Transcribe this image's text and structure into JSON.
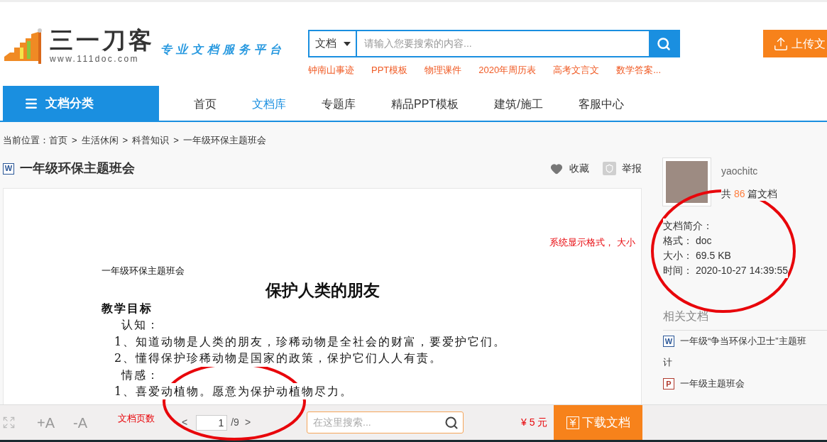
{
  "header": {
    "logo": {
      "name": "三一刀客",
      "domain": "www.111doc.com"
    },
    "tagline": "专业文档服务平台",
    "search": {
      "scope": "文档",
      "placeholder": "请输入您要搜索的内容..."
    },
    "hot_links": [
      "钟南山事迹",
      "PPT模板",
      "物理课件",
      "2020年周历表",
      "高考文言文",
      "数学答案..."
    ],
    "upload_button": "上传文"
  },
  "nav": {
    "category_button": "文档分类",
    "items": [
      {
        "label": "首页",
        "selected": false
      },
      {
        "label": "文档库",
        "selected": true
      },
      {
        "label": "专题库",
        "selected": false
      },
      {
        "label": "精品PPT模板",
        "selected": false
      },
      {
        "label": "建筑/施工",
        "selected": false
      },
      {
        "label": "客服中心",
        "selected": false
      }
    ]
  },
  "breadcrumb": {
    "prefix": "当前位置：",
    "separator": ">",
    "items": [
      "首页",
      "生活休闲",
      "科普知识",
      "一年级环保主题班会"
    ]
  },
  "document": {
    "kind": "word",
    "badge": "W",
    "title": "一年级环保主题班会",
    "actions": [
      {
        "kind": "favorite",
        "label": "收藏"
      },
      {
        "kind": "report",
        "label": "举报"
      }
    ],
    "page": {
      "header": "一年级环保主题班会",
      "heading": "保护人类的朋友",
      "lines": [
        {
          "kind": "section",
          "text": "教学目标"
        },
        {
          "kind": "subhead",
          "text": "认知："
        },
        {
          "kind": "item",
          "text": "1、知道动物是人类的朋友，珍稀动物是全社会的财富，要爱护它们。"
        },
        {
          "kind": "item",
          "text": "2、懂得保护珍稀动物是国家的政策，保护它们人人有责。"
        },
        {
          "kind": "subhead",
          "text": "情感："
        },
        {
          "kind": "item",
          "text": "1、喜爱动植物。愿意为保护动植物尽力。"
        }
      ]
    }
  },
  "annotations": [
    {
      "text": "系统显示格式， 大小"
    },
    {
      "text": "文档页数"
    }
  ],
  "toolbar": {
    "zoom_in": "+A",
    "zoom_out": "-A",
    "prev": "<",
    "page": "1",
    "total": "/9",
    "next": ">",
    "search_placeholder": "在这里搜索...",
    "price": "¥ 5 元",
    "download": "下载文档"
  },
  "uploader": {
    "name": "yaochitc",
    "count_prefix": "共",
    "count": "86",
    "count_suffix": "篇文档"
  },
  "info": {
    "title": "文档简介：",
    "rows": [
      {
        "label": "格式：",
        "value": "doc"
      },
      {
        "label": "大小：",
        "value": "69.5 KB"
      },
      {
        "label": "时间：",
        "value": "2020-10-27 14:39:55"
      }
    ]
  },
  "related": {
    "title": "相关文档",
    "items": [
      {
        "kind": "word",
        "badge": "W",
        "lines": [
          "一年级“争当环保小卫士”主题班",
          "计"
        ]
      },
      {
        "kind": "ppt",
        "badge": "P",
        "lines": [
          "一年级主题班会"
        ]
      }
    ]
  }
}
